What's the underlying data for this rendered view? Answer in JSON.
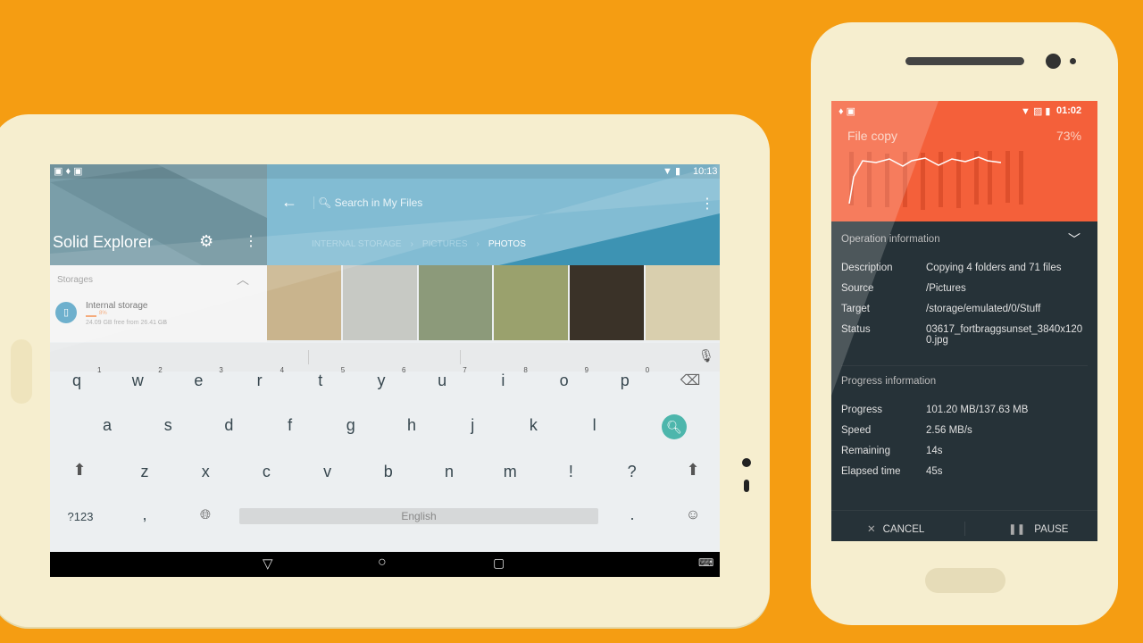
{
  "tablet": {
    "status": {
      "time": "10:13"
    },
    "sidebar": {
      "title": "Solid Explorer",
      "section": "Storages",
      "storage": {
        "name": "Internal storage",
        "percent": "8%",
        "percent_value": 8,
        "detail": "24.09 GB free from 26.41 GB"
      }
    },
    "search": {
      "placeholder": "Search in My Files"
    },
    "breadcrumb": [
      "INTERNAL STORAGE",
      "PICTURES",
      "PHOTOS"
    ],
    "thumbnails": [
      "#c9b48d",
      "#c7c9c4",
      "#8c9a7a",
      "#9aa16d",
      "#3a3228",
      "#d9cfae"
    ],
    "keyboard": {
      "row1": [
        "q",
        "w",
        "e",
        "r",
        "t",
        "y",
        "u",
        "i",
        "o",
        "p"
      ],
      "row1_hints": [
        "1",
        "2",
        "3",
        "4",
        "5",
        "6",
        "7",
        "8",
        "9",
        "0"
      ],
      "row2": [
        "a",
        "s",
        "d",
        "f",
        "g",
        "h",
        "j",
        "k",
        "l"
      ],
      "row3": [
        "z",
        "x",
        "c",
        "v",
        "b",
        "n",
        "m",
        "!",
        "?"
      ],
      "symbols": "?123",
      "comma": ",",
      "period": ".",
      "space": "English",
      "accent": "#4db6ac"
    }
  },
  "phone": {
    "status": {
      "time": "01:02"
    },
    "header": {
      "title": "File copy",
      "percent": "73%",
      "color": "#f4603a"
    },
    "operation": {
      "title": "Operation information",
      "rows": [
        {
          "label": "Description",
          "value": "Copying 4 folders and 71 files"
        },
        {
          "label": "Source",
          "value": "/Pictures"
        },
        {
          "label": "Target",
          "value": "/storage/emulated/0/Stuff"
        },
        {
          "label": "Status",
          "value": "03617_fortbraggsunset_3840x1200.jpg"
        }
      ]
    },
    "progress": {
      "title": "Progress information",
      "rows": [
        {
          "label": "Progress",
          "value": "101.20 MB/137.63 MB"
        },
        {
          "label": "Speed",
          "value": "2.56 MB/s"
        },
        {
          "label": "Remaining",
          "value": "14s"
        },
        {
          "label": "Elapsed time",
          "value": "45s"
        }
      ]
    },
    "actions": {
      "cancel": "CANCEL",
      "pause": "PAUSE"
    }
  }
}
